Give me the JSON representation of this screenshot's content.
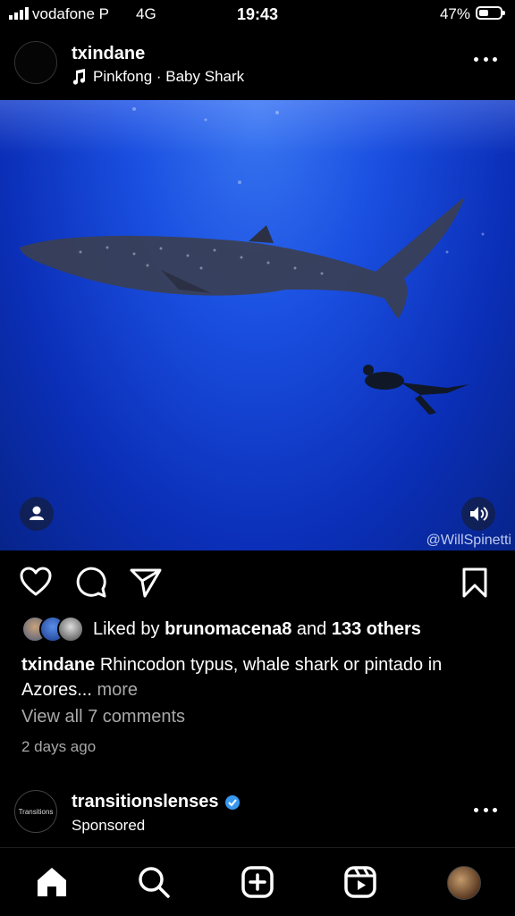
{
  "status_bar": {
    "carrier": "vodafone P",
    "network": "4G",
    "time": "19:43",
    "battery_percent": "47%",
    "battery_level": 0.47
  },
  "post": {
    "username": "txindane",
    "music": "Pinkfong · Baby Shark",
    "media_watermark": "@WillSpinetti",
    "likes": {
      "prefix": "Liked by",
      "user": "brunomacena8",
      "joiner": "and",
      "others": "133 others"
    },
    "caption": {
      "username": "txindane",
      "text": "Rhincodon typus, whale shark or pintado in Azores...",
      "more": "more"
    },
    "view_comments": "View all 7 comments",
    "posted_ago": "2 days ago"
  },
  "next_post": {
    "username": "transitionslenses",
    "label": "Sponsored",
    "avatar_text": "Transitions",
    "verified": true
  },
  "icons": {
    "like": "heart-icon",
    "comment": "comment-icon",
    "share": "send-icon",
    "save": "bookmark-icon",
    "more": "more-dots-icon",
    "music": "music-note-icon",
    "tag": "user-tag-icon",
    "volume": "volume-icon",
    "tabs": [
      "home-icon",
      "search-icon",
      "create-icon",
      "reels-icon",
      "profile-avatar"
    ]
  },
  "colors": {
    "background": "#000000",
    "muted_text": "#a8a8a8",
    "verified": "#3897f0",
    "water": "#1a4fe0"
  }
}
